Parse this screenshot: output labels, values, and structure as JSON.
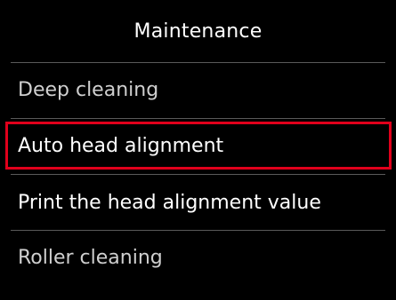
{
  "header": {
    "title": "Maintenance"
  },
  "menu": {
    "items": [
      {
        "label": "Deep cleaning",
        "selected": false
      },
      {
        "label": "Auto head alignment",
        "selected": true
      },
      {
        "label": "Print the head alignment value",
        "selected": false
      },
      {
        "label": "Roller cleaning",
        "selected": false
      }
    ]
  },
  "colors": {
    "background": "#000000",
    "text": "#ffffff",
    "selection_border": "#e0001b",
    "divider": "#5a5a5a"
  }
}
